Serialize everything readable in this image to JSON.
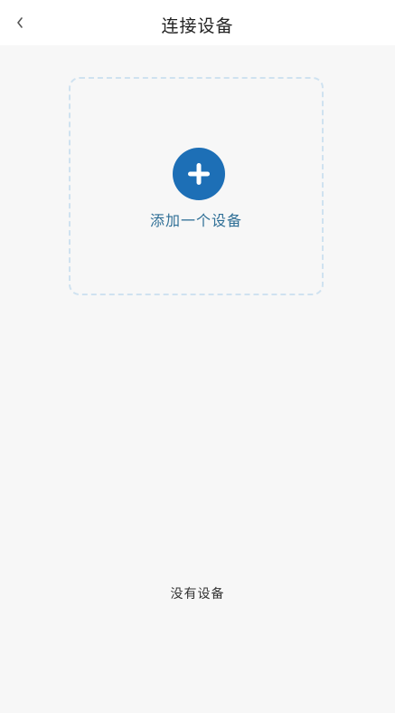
{
  "header": {
    "title": "连接设备",
    "back_icon": "chevron-left-icon"
  },
  "add_device": {
    "label": "添加一个设备",
    "icon": "plus-icon",
    "accent_color": "#1d6fb6"
  },
  "device_list": {
    "empty_text": "没有设备"
  }
}
